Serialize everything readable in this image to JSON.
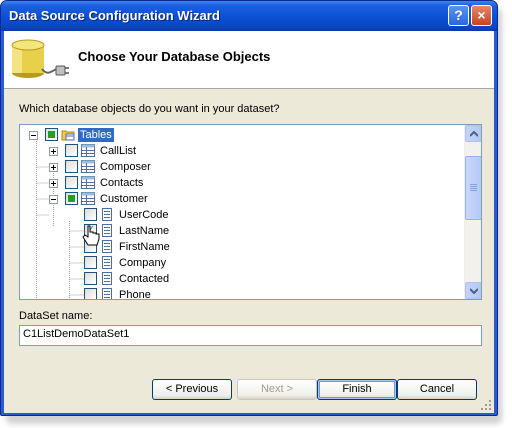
{
  "window": {
    "title": "Data Source Configuration Wizard",
    "help_label": "?",
    "close_label": "×"
  },
  "header": {
    "title": "Choose Your Database Objects",
    "icon": "database-connector-icon"
  },
  "prompt": "Which database objects do you want in your dataset?",
  "tree": {
    "root": {
      "label": "Tables",
      "state": "partial",
      "selected": true
    },
    "items": [
      {
        "label": "CallList",
        "state": "unchecked",
        "expanded": false,
        "icon": "table-icon"
      },
      {
        "label": "Composer",
        "state": "unchecked",
        "expanded": false,
        "icon": "table-icon"
      },
      {
        "label": "Contacts",
        "state": "unchecked",
        "expanded": false,
        "icon": "table-icon"
      },
      {
        "label": "Customer",
        "state": "partial",
        "expanded": true,
        "icon": "table-icon"
      }
    ],
    "columns": [
      {
        "label": "UserCode",
        "state": "unchecked",
        "icon": "column-icon"
      },
      {
        "label": "LastName",
        "state": "checked",
        "icon": "column-icon"
      },
      {
        "label": "FirstName",
        "state": "unchecked",
        "icon": "column-icon"
      },
      {
        "label": "Company",
        "state": "unchecked",
        "icon": "column-icon"
      },
      {
        "label": "Contacted",
        "state": "unchecked",
        "icon": "column-icon"
      },
      {
        "label": "Phone",
        "state": "unchecked",
        "icon": "column-icon"
      }
    ]
  },
  "dataset": {
    "label": "DataSet name:",
    "value": "C1ListDemoDataSet1"
  },
  "buttons": {
    "previous": "< Previous",
    "next": "Next >",
    "finish": "Finish",
    "cancel": "Cancel"
  },
  "colors": {
    "title_bar": "#0c4fd4",
    "selection": "#316ac5",
    "check_green": "#21a121"
  }
}
